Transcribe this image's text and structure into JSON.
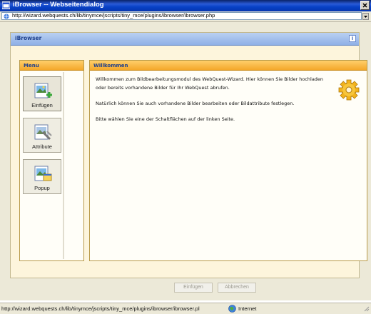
{
  "window": {
    "title": "iBrowser -- Webseitendialog",
    "url": "http://wizard.webquests.ch/lib/tinymce/jscripts/tiny_mce/plugins/ibrowser/ibrowser.php"
  },
  "panel": {
    "title": "iBrowser",
    "info_icon": "info-icon"
  },
  "menu": {
    "header": "Menu",
    "items": [
      {
        "label": "Einfügen",
        "icon": "insert-image-icon"
      },
      {
        "label": "Attribute",
        "icon": "image-attributes-icon"
      },
      {
        "label": "Popup",
        "icon": "popup-image-icon"
      }
    ]
  },
  "welcome": {
    "header": "Willkommen",
    "paragraphs": [
      "Willkommen zum Bildbearbeitungsmodul des WebQuest-Wizard. Hier können Sie Bilder hochladen oder bereits vorhandene Bilder für Ihr WebQuest abrufen.",
      "Natürlich können Sie auch vorhandene Bilder bearbeiten oder Bildattribute festlegen.",
      "Bitte wählen Sie eine der Schaltflächen auf der linken Seite."
    ],
    "icon": "gear-icon"
  },
  "actions": {
    "insert_label": "Einfügen",
    "cancel_label": "Abbrechen"
  },
  "status": {
    "text": "http://wizard.webquests.ch/lib/tinymce/jscripts/tiny_mce/plugins/ibrowser/ibrowser.pl",
    "zone": "Internet"
  },
  "colors": {
    "titlebar": "#0842c6",
    "panel_header": "#9fbbea",
    "box_header": "#f4a72a",
    "header_text": "#1d3f8c"
  }
}
